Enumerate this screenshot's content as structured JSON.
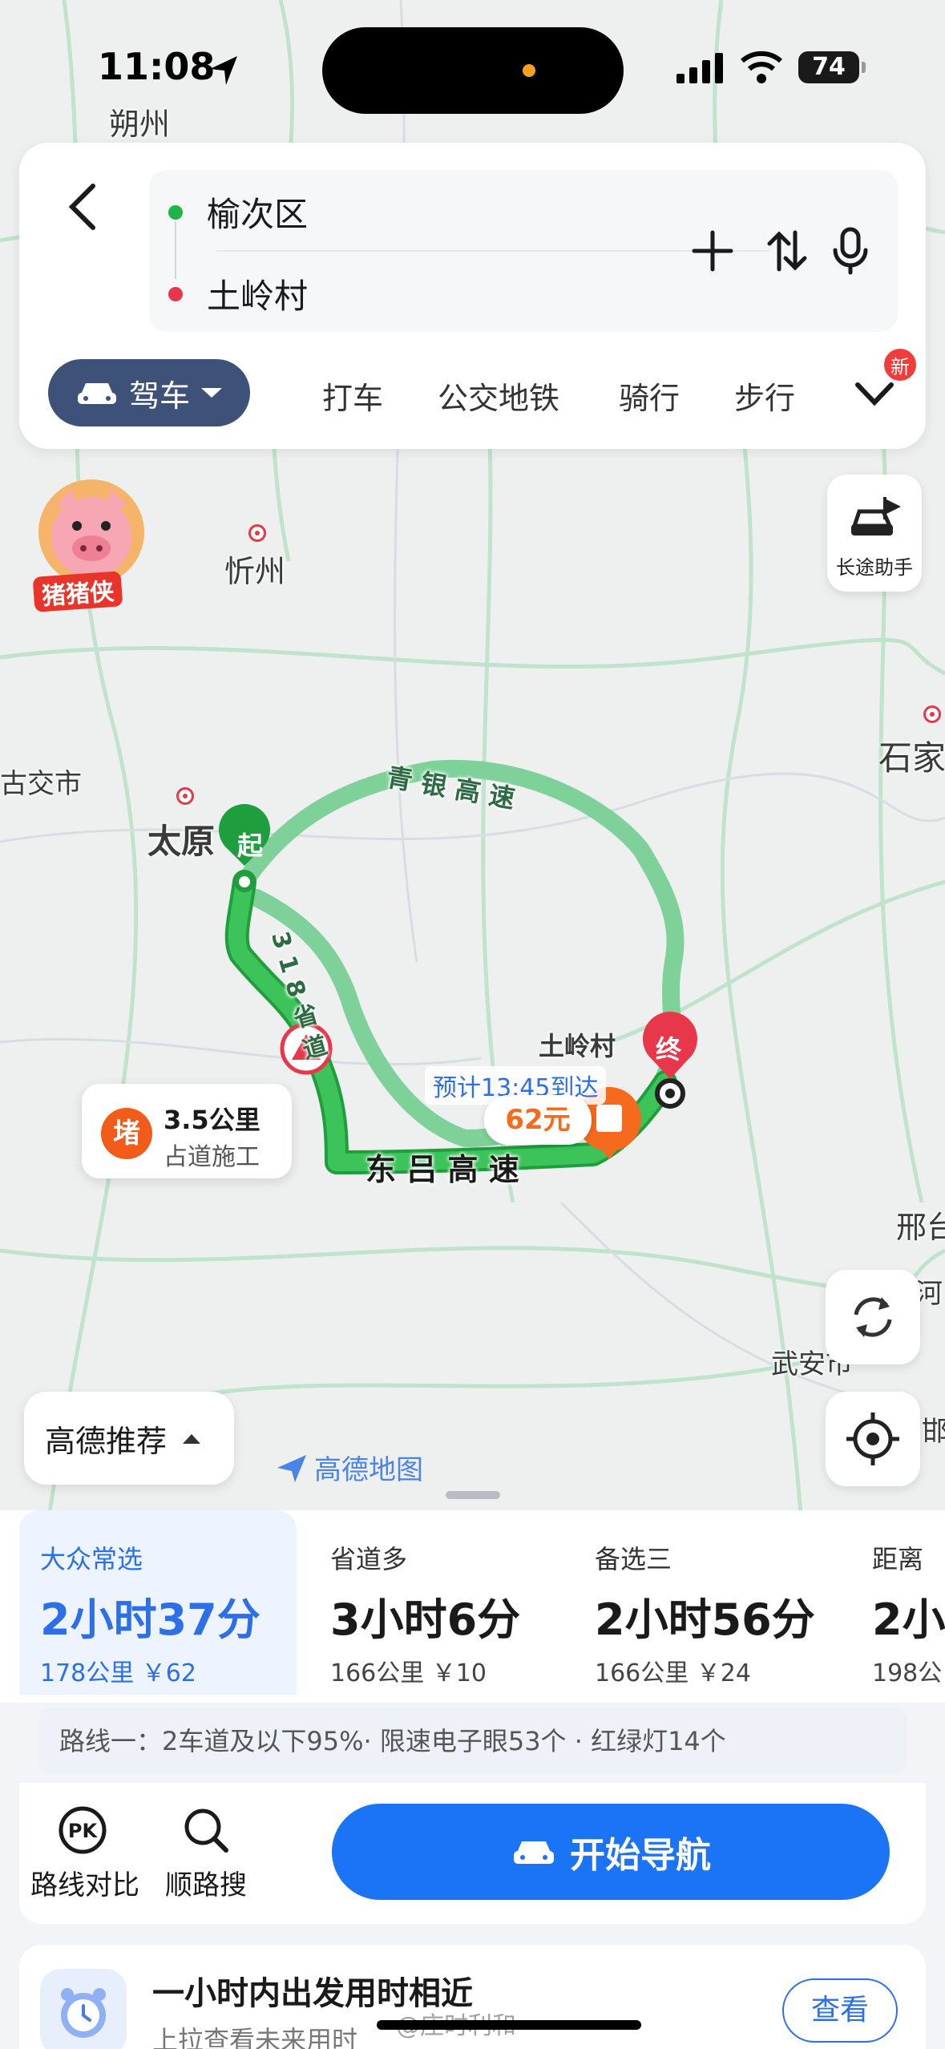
{
  "status": {
    "time": "11:08",
    "battery": "74"
  },
  "map": {
    "cities": [
      "朔州",
      "忻州",
      "太原",
      "古交市",
      "石家",
      "邢台",
      "武安市",
      "土岭村",
      "河",
      "邯"
    ],
    "roads": {
      "qingyin": "青 银 高 速",
      "sheng318": "3 1 8 省 道",
      "donglv": "东 吕 高 速"
    },
    "start_marker": "起",
    "end_marker": "终",
    "eta_label": "预计13:45到达",
    "toll_price": "62元",
    "jam": {
      "badge": "堵",
      "distance": "3.5公里",
      "reason": "占道施工"
    },
    "brand": "高德地图",
    "mascot_label": "猪猪侠"
  },
  "header": {
    "origin": "榆次区",
    "destination": "土岭村",
    "modes": {
      "active": "驾车",
      "taxi": "打车",
      "transit": "公交地铁",
      "ride": "骑行",
      "walk": "步行"
    },
    "new_badge": "新"
  },
  "controls": {
    "long_trip": "长途助手",
    "recommend": "高德推荐"
  },
  "routes": [
    {
      "name": "大众常选",
      "duration": "2小时37分",
      "meta": "178公里 ￥62"
    },
    {
      "name": "省道多",
      "duration": "3小时6分",
      "meta": "166公里 ￥10"
    },
    {
      "name": "备选三",
      "duration": "2小时56分",
      "meta": "166公里 ￥24"
    },
    {
      "name": "距离",
      "duration": "2小",
      "meta": "198公"
    }
  ],
  "route_summary": "路线一：2车道及以下95%· 限速电子眼53个 · 红绿灯14个",
  "actions": {
    "compare": "路线对比",
    "along_search": "顺路搜",
    "start_nav": "开始导航"
  },
  "tip": {
    "title": "一小时内出发用时相近",
    "subtitle": "上拉查看未来用时",
    "view": "查看"
  },
  "watermark": "@庄时利和",
  "colors": {
    "route_main": "#2bb34b",
    "route_alt": "#7fd19a",
    "accent_blue": "#1b73f5",
    "nav_header": "#3e5178"
  }
}
